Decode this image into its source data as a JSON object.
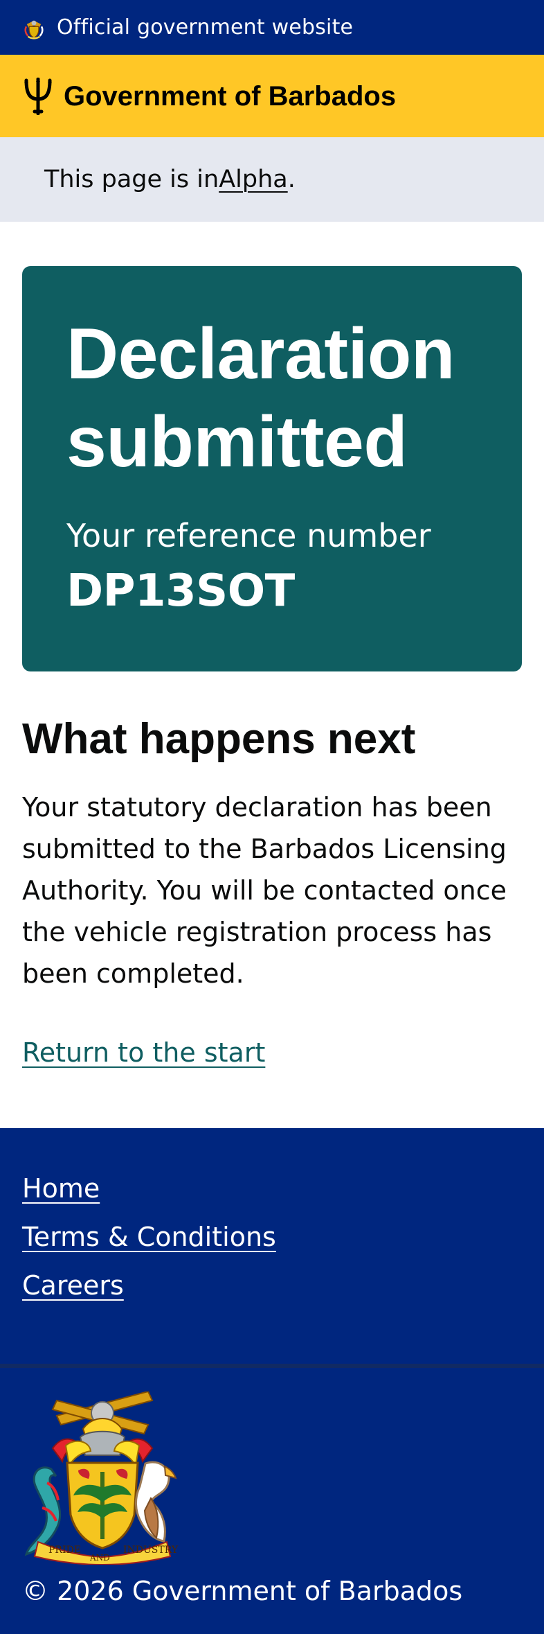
{
  "official_banner": {
    "text": "Official government website",
    "icon": "barbados-crest-icon"
  },
  "header": {
    "title": "Government of Barbados",
    "icon": "trident-icon"
  },
  "phase_banner": {
    "prefix": "This page is in ",
    "link_label": "Alpha",
    "suffix": "."
  },
  "confirmation": {
    "title": "Declaration submitted",
    "reference_label": "Your reference number",
    "reference_number": "DP13SOT"
  },
  "next_steps": {
    "heading": "What happens next",
    "body": "Your statutory declaration has been submitted to the Barbados Licensing Authority. You will be contacted once the vehicle registration process has been completed.",
    "return_link": "Return to the start"
  },
  "footer": {
    "links": [
      "Home",
      "Terms & Conditions",
      "Careers"
    ],
    "coat_of_arms_motto": [
      "PRIDE",
      "AND",
      "INDUSTRY"
    ],
    "copyright": "© 2026 Government of Barbados"
  },
  "colors": {
    "banner_blue": "#00267f",
    "header_yellow": "#ffc726",
    "phase_grey": "#e5e8f0",
    "panel_teal": "#0f5e61",
    "link_teal": "#0f5e61"
  }
}
